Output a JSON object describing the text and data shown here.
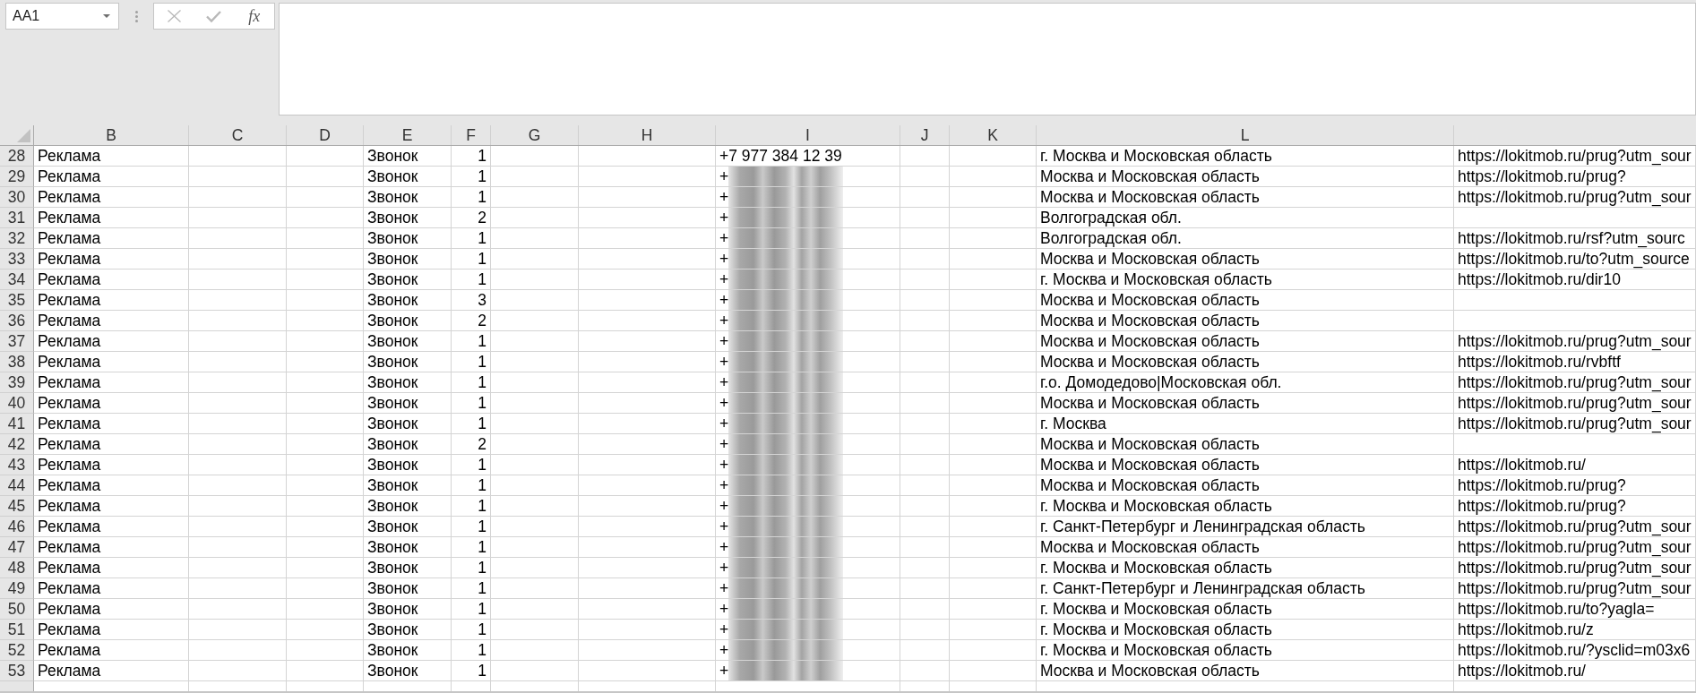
{
  "name_box": {
    "value": "AA1"
  },
  "formula_bar": {
    "function_button": "fx"
  },
  "columns": [
    {
      "heading": "B",
      "kind": "text"
    },
    {
      "heading": "C",
      "kind": "text"
    },
    {
      "heading": "D",
      "kind": "text"
    },
    {
      "heading": "E",
      "kind": "text"
    },
    {
      "heading": "F",
      "kind": "number"
    },
    {
      "heading": "G",
      "kind": "text"
    },
    {
      "heading": "H",
      "kind": "text"
    },
    {
      "heading": "I",
      "kind": "phone"
    },
    {
      "heading": "J",
      "kind": "text"
    },
    {
      "heading": "K",
      "kind": "text"
    },
    {
      "heading": "L",
      "kind": "text"
    },
    {
      "kind": "text"
    }
  ],
  "rows": [
    {
      "number": "28",
      "phone_redacted": false,
      "cells": [
        "Реклама",
        null,
        null,
        "Звонок",
        "1",
        null,
        null,
        "+7 977 384 12 39",
        null,
        null,
        "г. Москва и Московская область",
        "https://lokitmob.ru/prug?utm_sour"
      ]
    },
    {
      "number": "29",
      "phone_redacted": true,
      "cells": [
        "Реклама",
        null,
        null,
        "Звонок",
        "1",
        null,
        null,
        "+",
        null,
        null,
        "Москва и Московская область",
        "https://lokitmob.ru/prug?"
      ]
    },
    {
      "number": "30",
      "phone_redacted": true,
      "cells": [
        "Реклама",
        null,
        null,
        "Звонок",
        "1",
        null,
        null,
        "+",
        null,
        null,
        "Москва и Московская область",
        "https://lokitmob.ru/prug?utm_sour"
      ]
    },
    {
      "number": "31",
      "phone_redacted": true,
      "cells": [
        "Реклама",
        null,
        null,
        "Звонок",
        "2",
        null,
        null,
        "+",
        null,
        null,
        "Волгоградская обл.",
        null
      ]
    },
    {
      "number": "32",
      "phone_redacted": true,
      "cells": [
        "Реклама",
        null,
        null,
        "Звонок",
        "1",
        null,
        null,
        "+",
        null,
        null,
        "Волгоградская обл.",
        "https://lokitmob.ru/rsf?utm_sourc"
      ]
    },
    {
      "number": "33",
      "phone_redacted": true,
      "cells": [
        "Реклама",
        null,
        null,
        "Звонок",
        "1",
        null,
        null,
        "+",
        null,
        null,
        "Москва и Московская область",
        "https://lokitmob.ru/to?utm_source"
      ]
    },
    {
      "number": "34",
      "phone_redacted": true,
      "cells": [
        "Реклама",
        null,
        null,
        "Звонок",
        "1",
        null,
        null,
        "+",
        null,
        null,
        "г. Москва и Московская область",
        "https://lokitmob.ru/dir10"
      ]
    },
    {
      "number": "35",
      "phone_redacted": true,
      "cells": [
        "Реклама",
        null,
        null,
        "Звонок",
        "3",
        null,
        null,
        "+",
        null,
        null,
        "Москва и Московская область",
        null
      ]
    },
    {
      "number": "36",
      "phone_redacted": true,
      "cells": [
        "Реклама",
        null,
        null,
        "Звонок",
        "2",
        null,
        null,
        "+",
        null,
        null,
        "Москва и Московская область",
        null
      ]
    },
    {
      "number": "37",
      "phone_redacted": true,
      "cells": [
        "Реклама",
        null,
        null,
        "Звонок",
        "1",
        null,
        null,
        "+",
        null,
        null,
        "Москва и Московская область",
        "https://lokitmob.ru/prug?utm_sour"
      ]
    },
    {
      "number": "38",
      "phone_redacted": true,
      "cells": [
        "Реклама",
        null,
        null,
        "Звонок",
        "1",
        null,
        null,
        "+",
        null,
        null,
        "Москва и Московская область",
        "https://lokitmob.ru/rvbftf"
      ]
    },
    {
      "number": "39",
      "phone_redacted": true,
      "cells": [
        "Реклама",
        null,
        null,
        "Звонок",
        "1",
        null,
        null,
        "+",
        null,
        null,
        "г.о. Домодедово|Московская обл.",
        "https://lokitmob.ru/prug?utm_sour"
      ]
    },
    {
      "number": "40",
      "phone_redacted": true,
      "cells": [
        "Реклама",
        null,
        null,
        "Звонок",
        "1",
        null,
        null,
        "+",
        null,
        null,
        "Москва и Московская область",
        "https://lokitmob.ru/prug?utm_sour"
      ]
    },
    {
      "number": "41",
      "phone_redacted": true,
      "cells": [
        "Реклама",
        null,
        null,
        "Звонок",
        "1",
        null,
        null,
        "+",
        null,
        null,
        "г. Москва",
        "https://lokitmob.ru/prug?utm_sour"
      ]
    },
    {
      "number": "42",
      "phone_redacted": true,
      "cells": [
        "Реклама",
        null,
        null,
        "Звонок",
        "2",
        null,
        null,
        "+",
        null,
        null,
        "Москва и Московская область",
        null
      ]
    },
    {
      "number": "43",
      "phone_redacted": true,
      "cells": [
        "Реклама",
        null,
        null,
        "Звонок",
        "1",
        null,
        null,
        "+",
        null,
        null,
        "Москва и Московская область",
        "https://lokitmob.ru/"
      ]
    },
    {
      "number": "44",
      "phone_redacted": true,
      "cells": [
        "Реклама",
        null,
        null,
        "Звонок",
        "1",
        null,
        null,
        "+",
        null,
        null,
        "Москва и Московская область",
        "https://lokitmob.ru/prug?"
      ]
    },
    {
      "number": "45",
      "phone_redacted": true,
      "cells": [
        "Реклама",
        null,
        null,
        "Звонок",
        "1",
        null,
        null,
        "+",
        null,
        null,
        "г. Москва и Московская область",
        "https://lokitmob.ru/prug?"
      ]
    },
    {
      "number": "46",
      "phone_redacted": true,
      "cells": [
        "Реклама",
        null,
        null,
        "Звонок",
        "1",
        null,
        null,
        "+",
        null,
        null,
        "г. Санкт-Петербург и Ленинградская область",
        "https://lokitmob.ru/prug?utm_sour"
      ]
    },
    {
      "number": "47",
      "phone_redacted": true,
      "cells": [
        "Реклама",
        null,
        null,
        "Звонок",
        "1",
        null,
        null,
        "+",
        null,
        null,
        "Москва и Московская область",
        "https://lokitmob.ru/prug?utm_sour"
      ]
    },
    {
      "number": "48",
      "phone_redacted": true,
      "cells": [
        "Реклама",
        null,
        null,
        "Звонок",
        "1",
        null,
        null,
        "+",
        null,
        null,
        "г. Москва и Московская область",
        "https://lokitmob.ru/prug?utm_sour"
      ]
    },
    {
      "number": "49",
      "phone_redacted": true,
      "cells": [
        "Реклама",
        null,
        null,
        "Звонок",
        "1",
        null,
        null,
        "+",
        null,
        null,
        "г. Санкт-Петербург и Ленинградская область",
        "https://lokitmob.ru/prug?utm_sour"
      ]
    },
    {
      "number": "50",
      "phone_redacted": true,
      "cells": [
        "Реклама",
        null,
        null,
        "Звонок",
        "1",
        null,
        null,
        "+",
        null,
        null,
        "г. Москва и Московская область",
        "https://lokitmob.ru/to?yagla="
      ]
    },
    {
      "number": "51",
      "phone_redacted": true,
      "cells": [
        "Реклама",
        null,
        null,
        "Звонок",
        "1",
        null,
        null,
        "+",
        null,
        null,
        "г. Москва и Московская область",
        "https://lokitmob.ru/z"
      ]
    },
    {
      "number": "52",
      "phone_redacted": true,
      "cells": [
        "Реклама",
        null,
        null,
        "Звонок",
        "1",
        null,
        null,
        "+",
        null,
        null,
        "г. Москва и Московская область",
        "https://lokitmob.ru/?ysclid=m03x6"
      ]
    },
    {
      "number": "53",
      "phone_redacted": true,
      "cells": [
        "Реклама",
        null,
        null,
        "Звонок",
        "1",
        null,
        null,
        "+",
        null,
        null,
        "Москва и Московская область",
        "https://lokitmob.ru/"
      ]
    }
  ]
}
